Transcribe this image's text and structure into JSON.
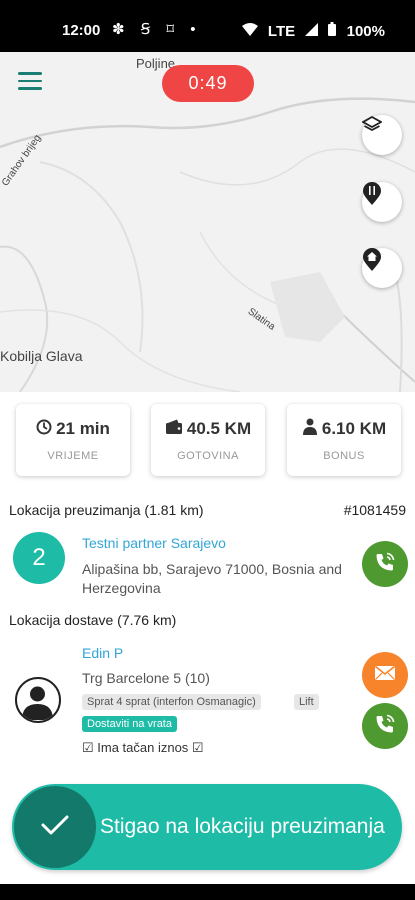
{
  "status_bar": {
    "time": "12:00",
    "notification_icons": "✽ Ꞩ ⌑ •",
    "network": "LTE",
    "battery": "100%"
  },
  "map": {
    "places": [
      "Poljine",
      "Grahov brijeg",
      "Slatina",
      "Kobilja Glava"
    ],
    "timer": "0:49"
  },
  "stats": [
    {
      "value": "21 min",
      "label": "VRIJEME",
      "icon": "clock-icon"
    },
    {
      "value": "40.5 KM",
      "label": "GOTOVINA",
      "icon": "wallet-icon"
    },
    {
      "value": "6.10 KM",
      "label": "BONUS",
      "icon": "person-bonus-icon"
    }
  ],
  "pickup": {
    "heading": "Lokacija preuzimanja (1.81 km)",
    "order_id": "#1081459",
    "stop_number": "2",
    "name": "Testni partner Sarajevo",
    "address_line1": "Alipašina bb, Sarajevo 71000, Bosnia and",
    "address_line2": "Herzegovina"
  },
  "delivery": {
    "heading": "Lokacija dostave (7.76 km)",
    "name": "Edin P",
    "address": "Trg Barcelone 5 (10)",
    "tags": [
      "Sprat 4 sprat (interfon Osmanagic)",
      "Lift"
    ],
    "highlight_tag": "Dostaviti na vrata",
    "checkbox_text": "☑ Ima tačan iznos ☑"
  },
  "swipe_action": {
    "label": "Stigao na lokaciju preuzimanja"
  },
  "colors": {
    "teal": "#1ebba6",
    "dark_teal": "#137a6b",
    "red": "#f04545",
    "green": "#4f9a30",
    "orange": "#f7832a",
    "link_blue": "#32a6d8"
  }
}
